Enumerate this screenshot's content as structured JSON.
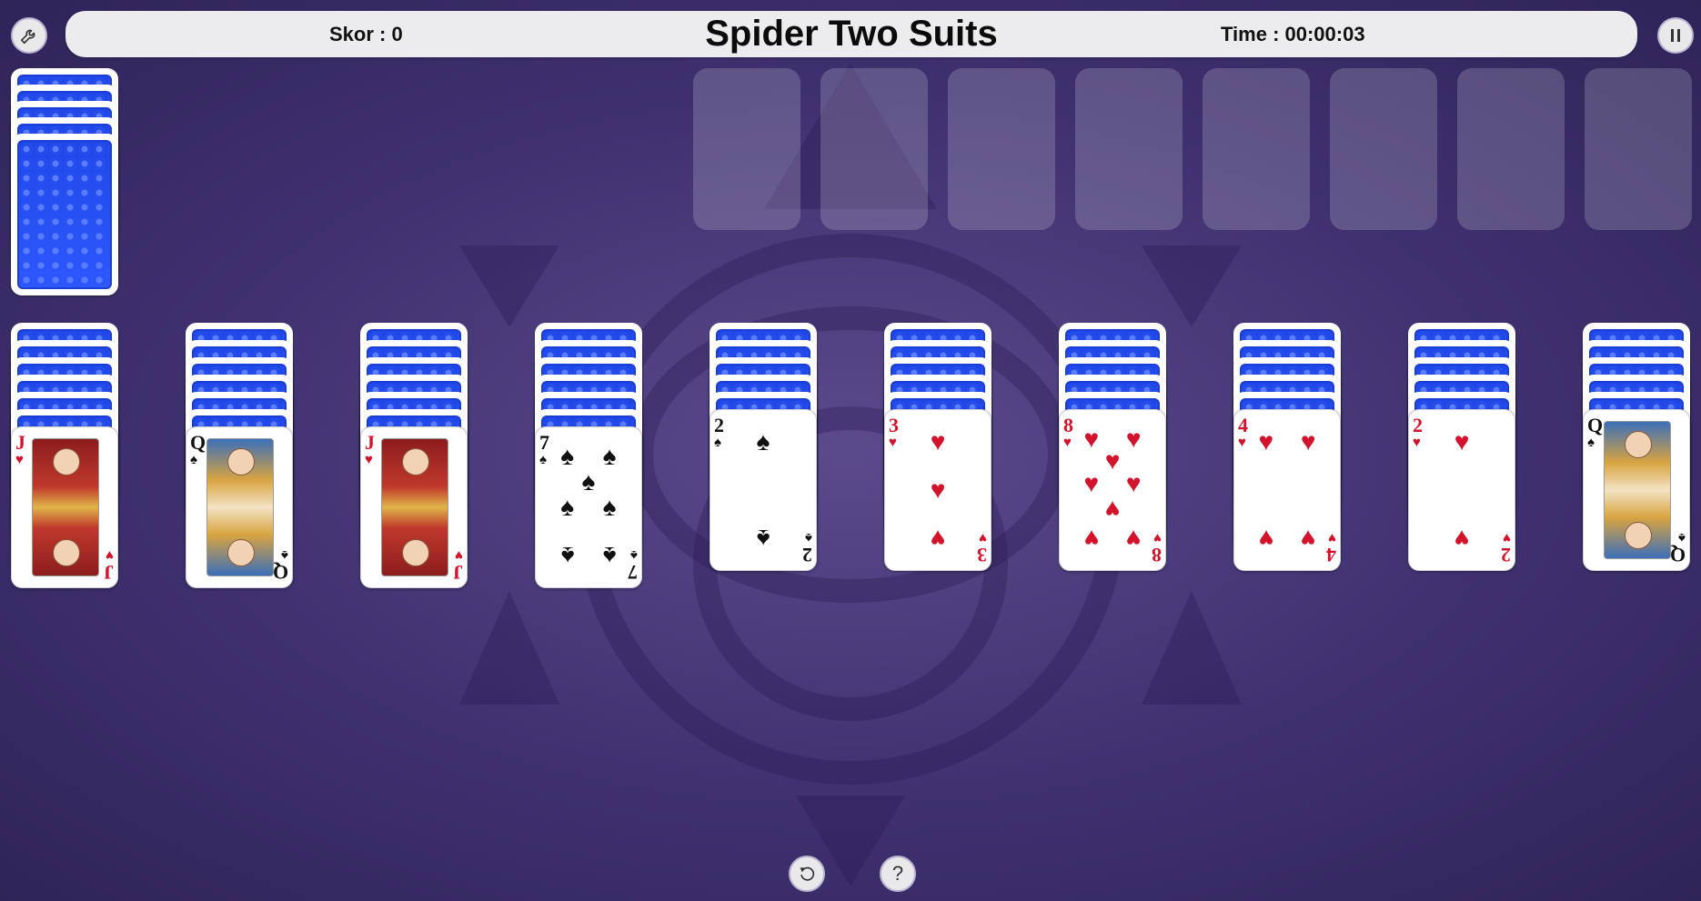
{
  "header": {
    "score_label": "Skor : 0",
    "title": "Spider Two Suits",
    "time_label": "Time : 00:00:03"
  },
  "buttons": {
    "settings_icon": "wrench-icon",
    "pause_icon": "pause-icon",
    "undo_icon": "undo-icon",
    "help_icon": "question-icon",
    "help_glyph": "?"
  },
  "colors": {
    "background": "#3f3170",
    "card_back": "#1f47e8",
    "red_suit": "#d3122b",
    "black_suit": "#111111"
  },
  "stock": {
    "face_down_cards": 5
  },
  "foundations": {
    "empty_slots": 8
  },
  "tableau": [
    {
      "face_down": 6,
      "top_card": {
        "rank": "J",
        "suit": "hearts"
      }
    },
    {
      "face_down": 6,
      "top_card": {
        "rank": "Q",
        "suit": "spades"
      }
    },
    {
      "face_down": 6,
      "top_card": {
        "rank": "J",
        "suit": "hearts"
      }
    },
    {
      "face_down": 6,
      "top_card": {
        "rank": "7",
        "suit": "spades"
      }
    },
    {
      "face_down": 5,
      "top_card": {
        "rank": "2",
        "suit": "spades"
      }
    },
    {
      "face_down": 5,
      "top_card": {
        "rank": "3",
        "suit": "hearts"
      }
    },
    {
      "face_down": 5,
      "top_card": {
        "rank": "8",
        "suit": "hearts"
      }
    },
    {
      "face_down": 5,
      "top_card": {
        "rank": "4",
        "suit": "hearts"
      }
    },
    {
      "face_down": 5,
      "top_card": {
        "rank": "2",
        "suit": "hearts"
      }
    },
    {
      "face_down": 5,
      "top_card": {
        "rank": "Q",
        "suit": "spades"
      }
    }
  ]
}
